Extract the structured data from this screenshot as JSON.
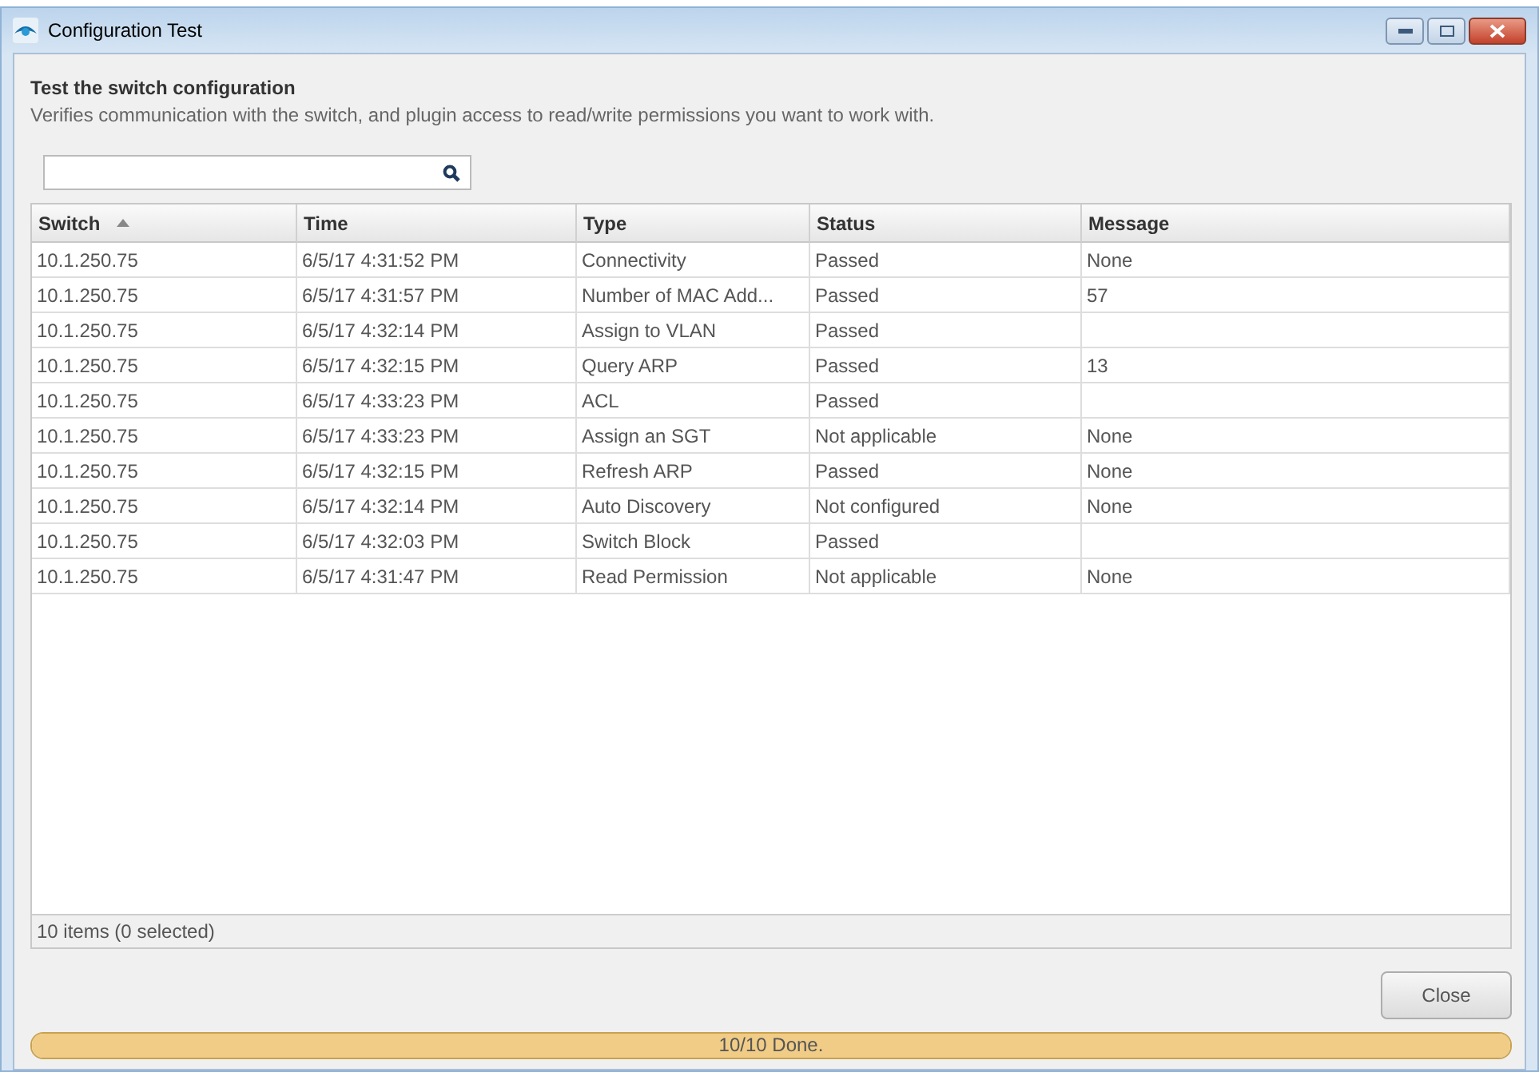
{
  "window": {
    "title": "Configuration Test"
  },
  "heading": "Test the switch configuration",
  "description": "Verifies communication with the switch, and plugin access to read/write permissions you want to work with.",
  "table": {
    "columns": [
      {
        "label": "Switch",
        "sorted": true
      },
      {
        "label": "Time",
        "sorted": false
      },
      {
        "label": "Type",
        "sorted": false
      },
      {
        "label": "Status",
        "sorted": false
      },
      {
        "label": "Message",
        "sorted": false
      }
    ],
    "rows": [
      [
        "10.1.250.75",
        "6/5/17 4:31:52 PM",
        "Connectivity",
        "Passed",
        "None"
      ],
      [
        "10.1.250.75",
        "6/5/17 4:31:57 PM",
        "Number of MAC Add...",
        "Passed",
        "57"
      ],
      [
        "10.1.250.75",
        "6/5/17 4:32:14 PM",
        "Assign to VLAN",
        "Passed",
        ""
      ],
      [
        "10.1.250.75",
        "6/5/17 4:32:15 PM",
        "Query ARP",
        "Passed",
        "13"
      ],
      [
        "10.1.250.75",
        "6/5/17 4:33:23 PM",
        "ACL",
        "Passed",
        ""
      ],
      [
        "10.1.250.75",
        "6/5/17 4:33:23 PM",
        "Assign an SGT",
        "Not applicable",
        "None"
      ],
      [
        "10.1.250.75",
        "6/5/17 4:32:15 PM",
        "Refresh ARP",
        "Passed",
        "None"
      ],
      [
        "10.1.250.75",
        "6/5/17 4:32:14 PM",
        "Auto Discovery",
        "Not configured",
        "None"
      ],
      [
        "10.1.250.75",
        "6/5/17 4:32:03 PM",
        "Switch Block",
        "Passed",
        ""
      ],
      [
        "10.1.250.75",
        "6/5/17 4:31:47 PM",
        "Read Permission",
        "Not applicable",
        "None"
      ]
    ],
    "footer": "10 items (0 selected)"
  },
  "buttons": [
    "Close"
  ],
  "progress": {
    "level": 1,
    "label": "10/10 Done."
  }
}
